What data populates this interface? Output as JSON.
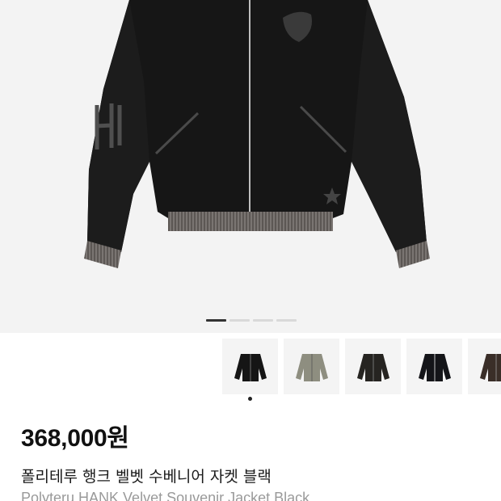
{
  "product": {
    "price": "368,000원",
    "title_ko": "폴리테루 행크 벨벳 수베니어 자켓 블랙",
    "title_en": "Polyteru HANK Velvet Souvenir Jacket Black"
  },
  "gallery": {
    "slide_count": 4,
    "active_slide": 1,
    "thumbnails": [
      {
        "name": "jacket-black-front",
        "color": "#151515"
      },
      {
        "name": "jacket-khaki-reverse",
        "color": "#8e8e80"
      },
      {
        "name": "jacket-black-velvet",
        "color": "#262421"
      },
      {
        "name": "jacket-black-satin",
        "color": "#141519"
      },
      {
        "name": "jacket-brown-velvet",
        "color": "#3a2e28"
      }
    ],
    "selected_thumbnail": 1
  },
  "colors": {
    "background": "#f3f3f3",
    "jacket": "#161616",
    "ribbing": "#77726e"
  }
}
